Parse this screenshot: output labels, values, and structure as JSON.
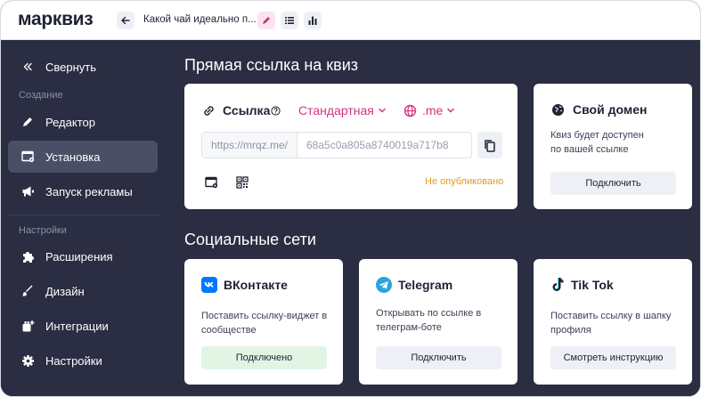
{
  "app": {
    "logo": "марквиз",
    "quiz_title": "Какой чай идеально п..."
  },
  "sidebar": {
    "collapse_label": "Свернуть",
    "section_create": "Создание",
    "section_settings": "Настройки",
    "items": [
      {
        "label": "Редактор",
        "icon": "pencil-icon"
      },
      {
        "label": "Установка",
        "icon": "install-icon",
        "active": true
      },
      {
        "label": "Запуск рекламы",
        "icon": "megaphone-icon"
      },
      {
        "label": "Расширения",
        "icon": "puzzle-icon"
      },
      {
        "label": "Дизайн",
        "icon": "brush-icon"
      },
      {
        "label": "Интеграции",
        "icon": "integrations-icon"
      },
      {
        "label": "Настройки",
        "icon": "gear-icon"
      }
    ]
  },
  "main": {
    "direct_link_title": "Прямая ссылка на квиз",
    "link_card": {
      "label": "Ссылка",
      "type_value": "Стандартная",
      "domain_value": ".me",
      "url_prefix": "https://mrqz.me/",
      "url_id": "68a5c0a805a8740019a717b8",
      "status": "Не опубликовано"
    },
    "domain_card": {
      "title": "Свой домен",
      "text_line1": "Квиз будет доступен",
      "text_line2": "по вашей ссылке",
      "button": "Подключить"
    },
    "social_title": "Социальные сети",
    "social": [
      {
        "title": "ВКонтакте",
        "line1": "Поставить ссылку-виджет в",
        "line2": "сообществе",
        "button": "Подключено"
      },
      {
        "title": "Telegram",
        "line1": "Открывать по ссылке в",
        "line2": "телеграм-боте",
        "button": "Подключить"
      },
      {
        "title": "Tik Tok",
        "line1": "Поставить ссылку в шапку",
        "line2": "профиля",
        "button": "Смотреть инструкцию"
      }
    ]
  },
  "colors": {
    "sidebar_bg": "#2b2d42",
    "accent_pink": "#d3337f",
    "status_orange": "#e39a1b",
    "connected_green": "#e2f5e5",
    "vk_blue": "#0077ff",
    "telegram_blue": "#2aa3df"
  }
}
